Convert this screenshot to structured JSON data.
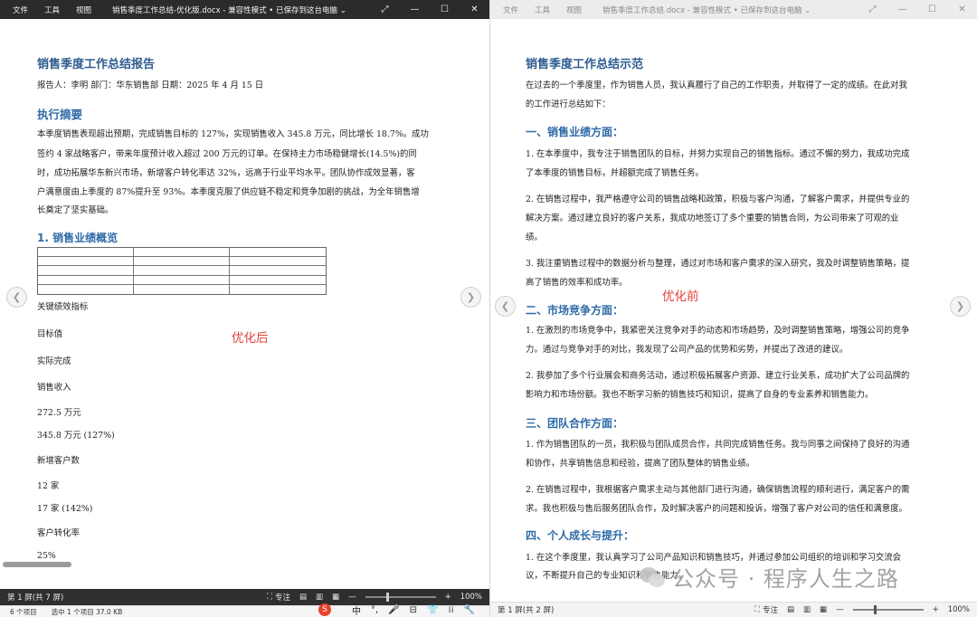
{
  "left_window": {
    "menu": [
      "文件",
      "工具",
      "视图"
    ],
    "doc_title": "销售季度工作总结-优化版.docx - 兼容性模式 • 已保存到这台电脑 ⌄",
    "controls": [
      "⤢",
      "—",
      "☐",
      "✕"
    ],
    "content": {
      "title": "销售季度工作总结报告",
      "meta": "报告人：李明    部门：华东销售部    日期：2025 年 4 月 15 日",
      "summary_heading": "执行摘要",
      "summary_lines": [
        "本季度销售表现超出预期，完成销售目标的 127%，实现销售收入 345.8 万元，同比增长 18.7%。成功",
        "签约 4 家战略客户，带来年度预计收入超过 200 万元的订单。在保持主力市场稳健增长(14.5%)的同",
        "时，成功拓展华东新兴市场，新增客户转化率达 32%，远高于行业平均水平。团队协作成效显著，客",
        "户满意度由上季度的 87%提升至 93%。本季度克服了供应链不稳定和竞争加剧的挑战，为全年销售增",
        "长奠定了坚实基础。"
      ],
      "section1_heading": "1. 销售业绩概览",
      "list_lines": [
        "关键绩效指标",
        "目标值",
        "实际完成",
        "销售收入",
        "272.5 万元",
        "345.8 万元 (127%)",
        "新增客户数",
        "12 家",
        "17 家 (142%)",
        "客户转化率",
        "25%"
      ],
      "annotation": "优化后"
    },
    "statusbar": {
      "page": "第 1 屏(共 7 屏)",
      "focus": "专注",
      "zoom": "100%"
    },
    "explorer": {
      "items": "6 个项目",
      "selected": "选中 1 个项目  37.0 KB"
    }
  },
  "right_window": {
    "menu": [
      "文件",
      "工具",
      "视图"
    ],
    "doc_title": "销售季度工作总结.docx - 兼容性模式 • 已保存到这台电脑 ⌄",
    "controls": [
      "⤢",
      "—",
      "☐",
      "✕"
    ],
    "content": {
      "title": "销售季度工作总结示范",
      "intro_line1": "在过去的一个季度里，作为销售人员，我认真履行了自己的工作职责，并取得了一定的成绩。在此对我",
      "intro_line2": "的工作进行总结如下：",
      "h_sales": "一、销售业绩方面：",
      "sales_p1_l1": "1. 在本季度中，我专注于销售团队的目标，并努力实现自己的销售指标。通过不懈的努力，我成功完成",
      "sales_p1_l2": "了本季度的销售目标，并超额完成了销售任务。",
      "sales_p2_l1": "2. 在销售过程中，我严格遵守公司的销售战略和政策，积极与客户沟通，了解客户需求，并提供专业的",
      "sales_p2_l2": "解决方案。通过建立良好的客户关系，我成功地签订了多个重要的销售合同，为公司带来了可观的业",
      "sales_p2_l3": "绩。",
      "sales_p3_l1": "3. 我注重销售过程中的数据分析与整理，通过对市场和客户需求的深入研究，我及时调整销售策略，提",
      "sales_p3_l2": "高了销售的效率和成功率。",
      "h_market": "二、市场竞争方面：",
      "market_p1_l1": "1. 在激烈的市场竞争中，我紧密关注竞争对手的动态和市场趋势，及时调整销售策略，增强公司的竞争",
      "market_p1_l2": "力。通过与竞争对手的对比，我发现了公司产品的优势和劣势，并提出了改进的建议。",
      "market_p2_l1": "2. 我参加了多个行业展会和商务活动，通过积极拓展客户资源、建立行业关系，成功扩大了公司品牌的",
      "market_p2_l2": "影响力和市场份额。我也不断学习新的销售技巧和知识，提高了自身的专业素养和销售能力。",
      "h_team": "三、团队合作方面：",
      "team_p1_l1": "1. 作为销售团队的一员，我积极与团队成员合作，共同完成销售任务。我与同事之间保持了良好的沟通",
      "team_p1_l2": "和协作，共享销售信息和经验，提高了团队整体的销售业绩。",
      "team_p2_l1": "2. 在销售过程中，我根据客户需求主动与其他部门进行沟通，确保销售流程的顺利进行，满足客户的需",
      "team_p2_l2": "求。我也积极与售后服务团队合作，及时解决客户的问题和投诉，增强了客户对公司的信任和满意度。",
      "h_growth": "四、个人成长与提升：",
      "growth_p1_l1": "1. 在这个季度里，我认真学习了公司产品知识和销售技巧，并通过参加公司组织的培训和学习交流会",
      "growth_p1_l2": "议，不断提升自己的专业知识和销售能力。",
      "annotation": "优化前"
    },
    "statusbar": {
      "page": "第 1 屏(共 2 屏)",
      "focus": "专注",
      "zoom": "100%"
    }
  },
  "taskbar_ime": {
    "logo": "S",
    "items": [
      "中",
      "°,",
      "🎤",
      "⊟",
      "👕",
      "⁞⁞",
      "🔧"
    ]
  },
  "watermark": "公众号 · 程序人生之路"
}
